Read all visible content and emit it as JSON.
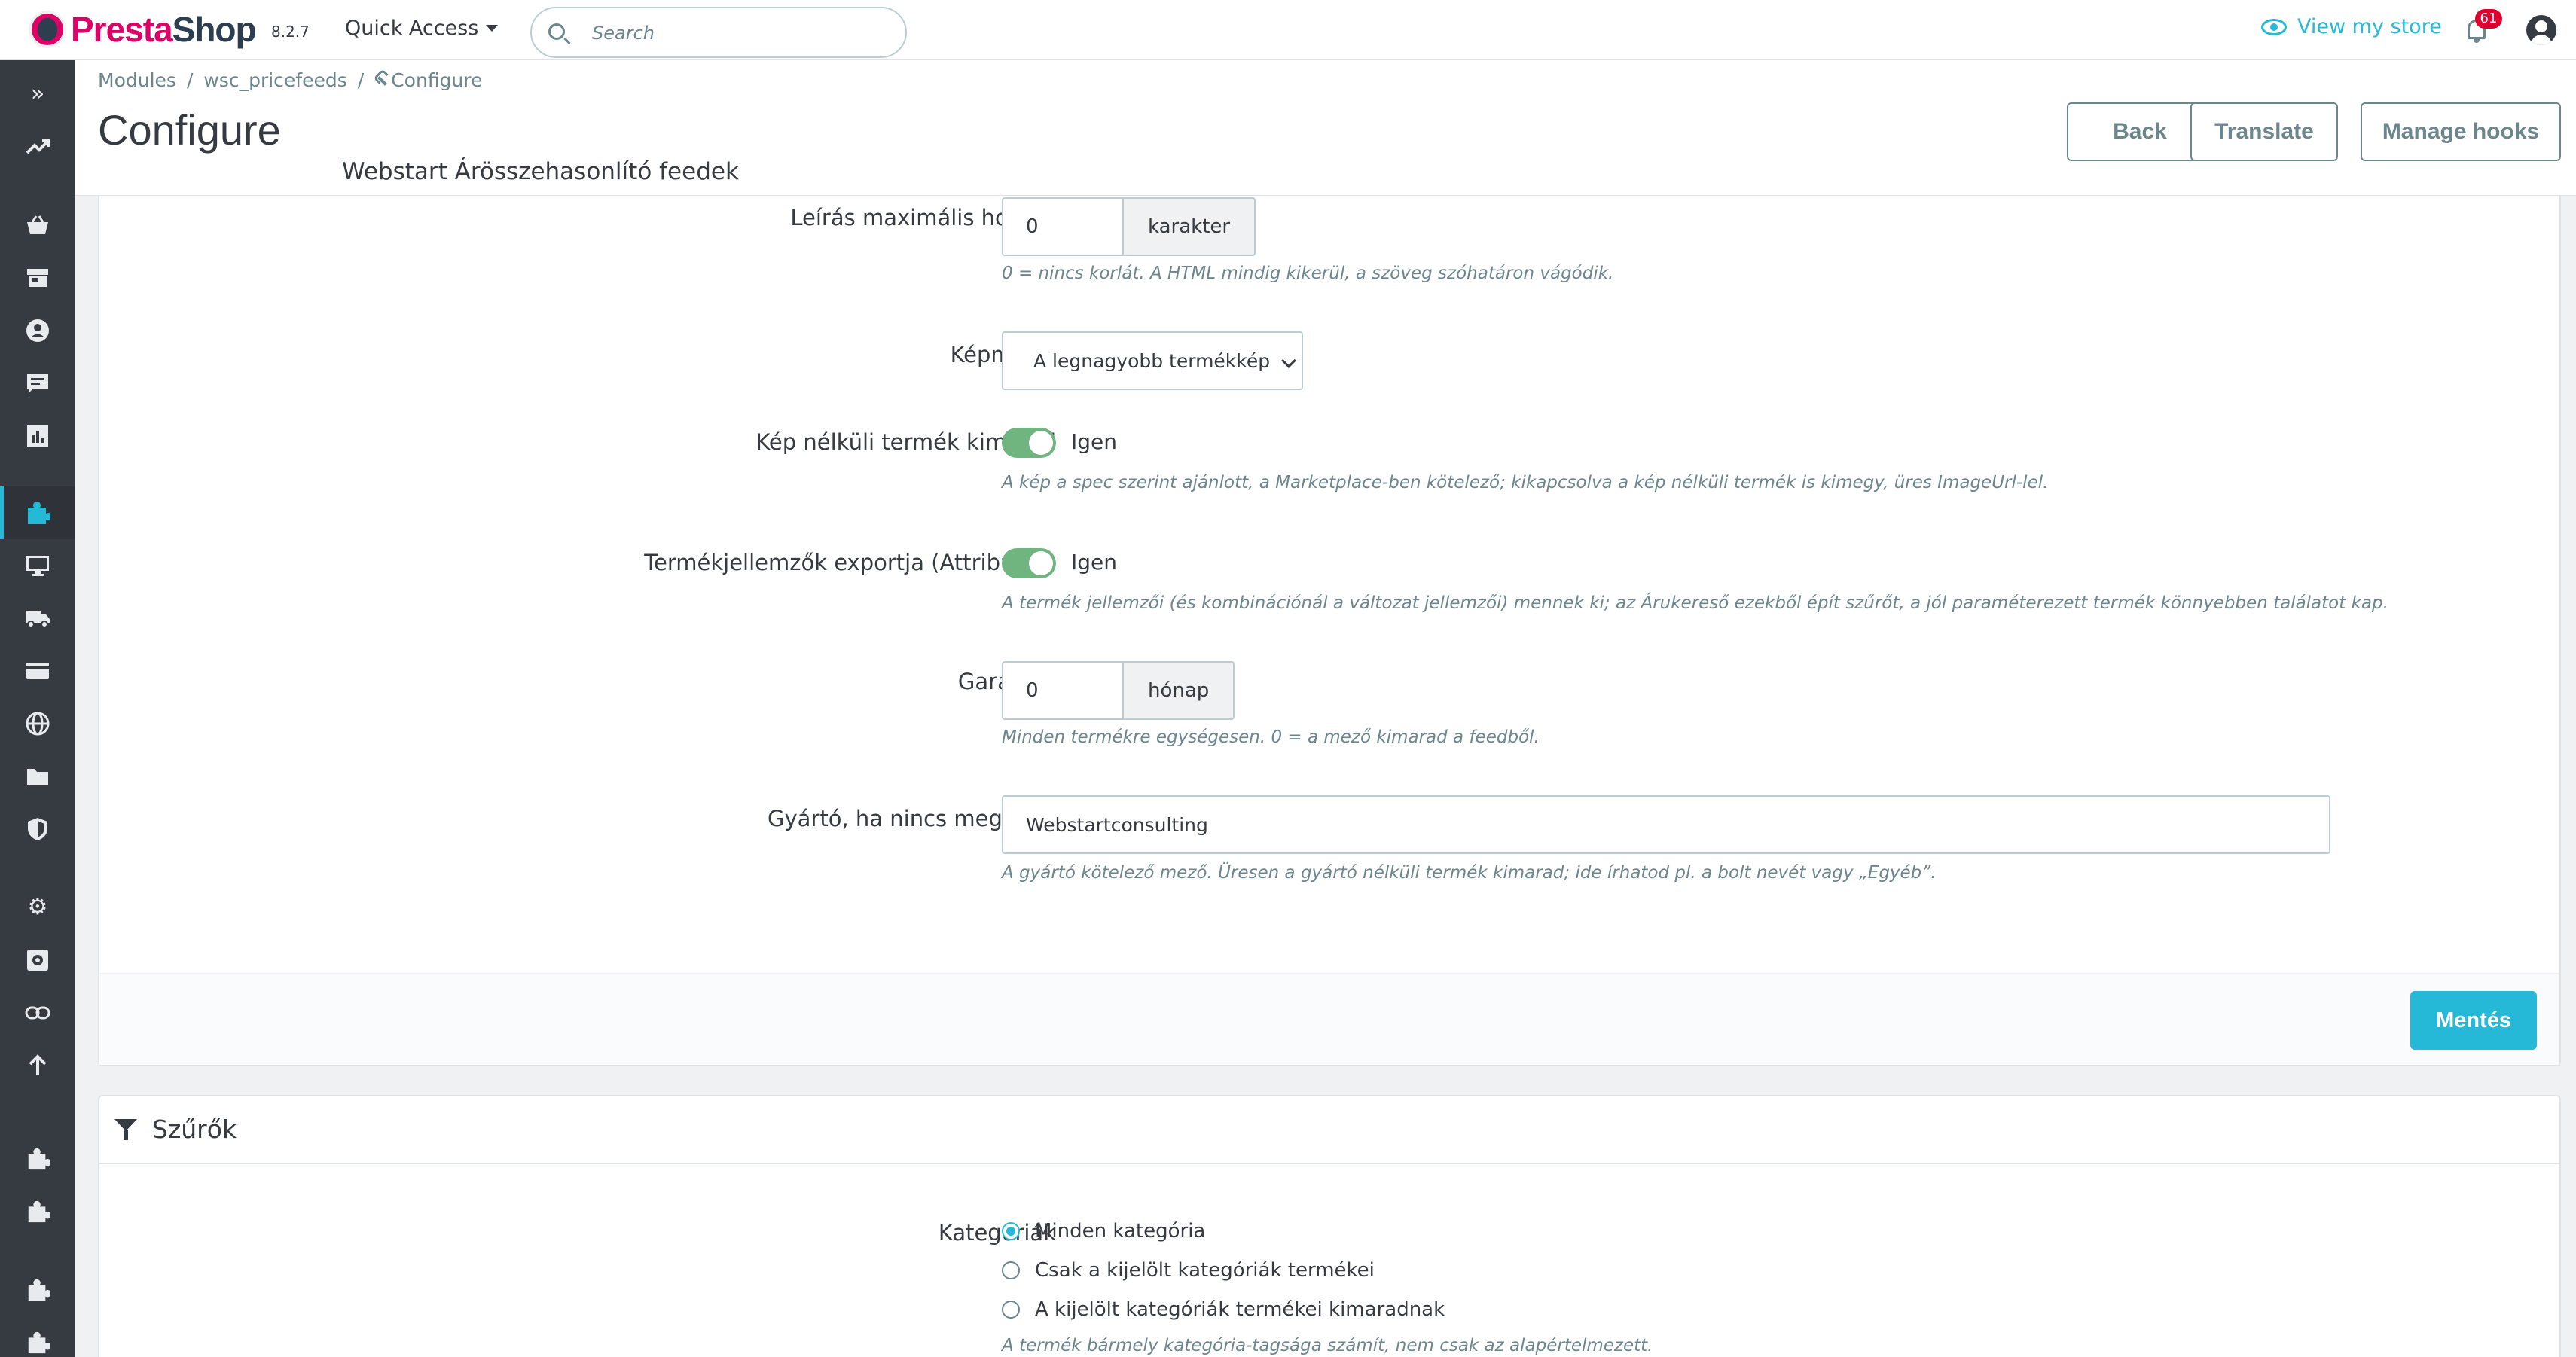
{
  "header": {
    "brand_presta": "Presta",
    "brand_shop": "Shop",
    "version": "8.2.7",
    "quick_access": "Quick Access",
    "search_placeholder": "Search",
    "view_store": "View my store",
    "notifications_count": "61"
  },
  "sidebar": {
    "items": [
      {
        "name": "collapse",
        "glyph": "»"
      },
      {
        "name": "dashboard",
        "glyph": "↗"
      },
      {
        "name": "orders",
        "glyph": "basket"
      },
      {
        "name": "catalog",
        "glyph": "store"
      },
      {
        "name": "customers",
        "glyph": "user"
      },
      {
        "name": "customer-service",
        "glyph": "chat"
      },
      {
        "name": "stats",
        "glyph": "chart"
      },
      {
        "name": "modules",
        "glyph": "puzzle",
        "active": true
      },
      {
        "name": "design",
        "glyph": "monitor"
      },
      {
        "name": "shipping",
        "glyph": "truck"
      },
      {
        "name": "payment",
        "glyph": "card"
      },
      {
        "name": "international",
        "glyph": "globe"
      },
      {
        "name": "tags",
        "glyph": "tag"
      },
      {
        "name": "security",
        "glyph": "shield"
      },
      {
        "name": "settings",
        "glyph": "gear"
      },
      {
        "name": "advanced",
        "glyph": "gear-box"
      },
      {
        "name": "link",
        "glyph": "link"
      },
      {
        "name": "upgrade",
        "glyph": "arrow-up"
      },
      {
        "name": "module-a",
        "glyph": "puzzle"
      },
      {
        "name": "module-b",
        "glyph": "puzzle"
      },
      {
        "name": "module-c",
        "glyph": "puzzle"
      },
      {
        "name": "module-d",
        "glyph": "puzzle"
      }
    ]
  },
  "breadcrumb": {
    "modules": "Modules",
    "module": "wsc_pricefeeds",
    "configure": "Configure",
    "sep": "/"
  },
  "page": {
    "title": "Configure",
    "subtitle": "Webstart Árösszehasonlító feedek",
    "back": "Back",
    "translate": "Translate",
    "manage_hooks": "Manage hooks"
  },
  "form": {
    "desc_length": {
      "label": "Leírás maximális hossza",
      "value": "0",
      "addon": "karakter",
      "help": "0 = nincs korlát. A HTML mindig kikerül, a szöveg szóhatáron vágódik."
    },
    "image_size": {
      "label": "Képméret",
      "value": "A legnagyobb termékkép-r"
    },
    "no_image": {
      "label": "Kép nélküli termék kimarad",
      "value": "Igen",
      "help": "A kép a spec szerint ajánlott, a Marketplace-ben kötelező; kikapcsolva a kép nélküli termék is kimegy, üres ImageUrl-lel."
    },
    "attributes": {
      "label": "Termékjellemzők exportja (Attributes)",
      "value": "Igen",
      "help": "A termék jellemzői (és kombinációnál a változat jellemzői) mennek ki; az Árukereső ezekből épít szűrőt, a jól paraméterezett termék könnyebben találatot kap."
    },
    "warranty": {
      "label": "Garancia",
      "value": "0",
      "addon": "hónap",
      "help": "Minden termékre egységesen. 0 = a mező kimarad a feedből."
    },
    "manufacturer": {
      "label": "Gyártó, ha nincs megadva",
      "value": "Webstartconsulting",
      "help": "A gyártó kötelező mező. Üresen a gyártó nélküli termék kimarad; ide írhatod pl. a bolt nevét vagy „Egyéb”."
    },
    "save": "Mentés"
  },
  "filters": {
    "title": "Szűrők",
    "categories_label": "Kategóriák",
    "options": [
      {
        "label": "Minden kategória",
        "checked": true
      },
      {
        "label": "Csak a kijelölt kategóriák termékei",
        "checked": false
      },
      {
        "label": "A kijelölt kategóriák termékei kimaradnak",
        "checked": false
      }
    ],
    "help": "A termék bármely kategória-tagsága számít, nem csak az alapértelmezett."
  },
  "colors": {
    "accent": "#25b9d7",
    "brand": "#df0067",
    "toggle_on": "#70b580",
    "sidebar": "#363a41"
  }
}
